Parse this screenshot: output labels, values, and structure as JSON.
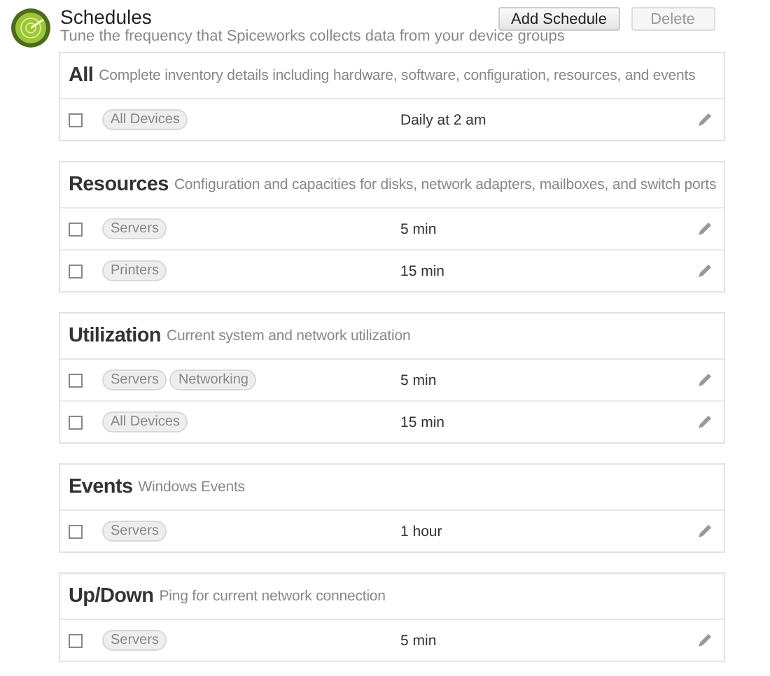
{
  "header": {
    "title": "Schedules",
    "subtitle": "Tune the frequency that Spiceworks collects data from your device groups"
  },
  "buttons": [
    {
      "label": "Add Schedule",
      "disabled": false
    },
    {
      "label": "Delete",
      "disabled": true
    }
  ],
  "sections": [
    {
      "title": "All",
      "description": "Complete inventory details including hardware, software, configuration, resources, and events",
      "rows": [
        {
          "checked": false,
          "groups": [
            "All Devices"
          ],
          "frequency": "Daily at 2 am"
        }
      ]
    },
    {
      "title": "Resources",
      "description": "Configuration and capacities for disks, network adapters, mailboxes, and switch ports",
      "rows": [
        {
          "checked": false,
          "groups": [
            "Servers"
          ],
          "frequency": "5 min"
        },
        {
          "checked": false,
          "groups": [
            "Printers"
          ],
          "frequency": "15 min"
        }
      ]
    },
    {
      "title": "Utilization",
      "description": "Current system and network utilization",
      "rows": [
        {
          "checked": false,
          "groups": [
            "Servers",
            "Networking"
          ],
          "frequency": "5 min"
        },
        {
          "checked": false,
          "groups": [
            "All Devices"
          ],
          "frequency": "15 min"
        }
      ]
    },
    {
      "title": "Events",
      "description": "Windows Events",
      "rows": [
        {
          "checked": false,
          "groups": [
            "Servers"
          ],
          "frequency": "1 hour"
        }
      ]
    },
    {
      "title": "Up/Down",
      "description": "Ping for current network connection",
      "rows": [
        {
          "checked": false,
          "groups": [
            "Servers"
          ],
          "frequency": "5 min"
        }
      ]
    }
  ]
}
